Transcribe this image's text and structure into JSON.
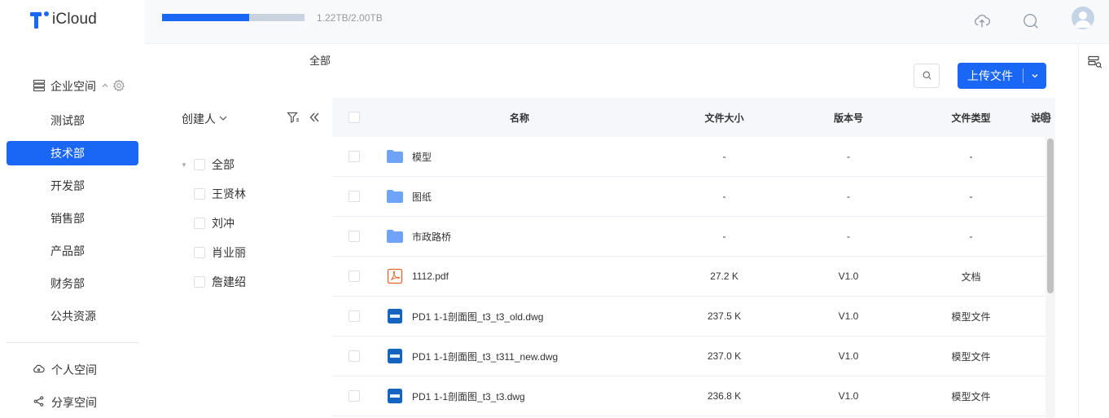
{
  "app": {
    "name": "iCloud"
  },
  "storage": {
    "text": "1.22TB/2.00TB",
    "used_fraction": 0.61
  },
  "sidebar": {
    "enterprise_label": "企业空间",
    "departments": [
      {
        "label": "测试部",
        "active": false
      },
      {
        "label": "技术部",
        "active": true
      },
      {
        "label": "开发部",
        "active": false
      },
      {
        "label": "销售部",
        "active": false
      },
      {
        "label": "产品部",
        "active": false
      },
      {
        "label": "财务部",
        "active": false
      },
      {
        "label": "公共资源",
        "active": false
      }
    ],
    "personal_label": "个人空间",
    "share_label": "分享空间"
  },
  "breadcrumb": "全部",
  "toolbar": {
    "upload_label": "上传文件"
  },
  "creator_filter": {
    "header": "创建人",
    "items": [
      "全部",
      "王贤林",
      "刘冲",
      "肖业丽",
      "詹建绍"
    ]
  },
  "table": {
    "columns": {
      "name": "名称",
      "size": "文件大小",
      "version": "版本号",
      "type": "文件类型",
      "desc": "说明"
    },
    "rows": [
      {
        "icon": "folder-icon",
        "name": "模型",
        "size": "-",
        "version": "-",
        "type": "-"
      },
      {
        "icon": "folder-icon",
        "name": "图纸",
        "size": "-",
        "version": "-",
        "type": "-"
      },
      {
        "icon": "folder-icon",
        "name": "市政路桥",
        "size": "-",
        "version": "-",
        "type": "-"
      },
      {
        "icon": "pdf-icon",
        "name": "1112.pdf",
        "size": "27.2 K",
        "version": "V1.0",
        "type": "文档"
      },
      {
        "icon": "dwg-icon",
        "name": "PD1 1-1剖面图_t3_t3_old.dwg",
        "size": "237.5 K",
        "version": "V1.0",
        "type": "模型文件"
      },
      {
        "icon": "dwg-icon",
        "name": "PD1 1-1剖面图_t3_t311_new.dwg",
        "size": "237.0 K",
        "version": "V1.0",
        "type": "模型文件"
      },
      {
        "icon": "dwg-icon",
        "name": "PD1 1-1剖面图_t3_t3.dwg",
        "size": "236.8 K",
        "version": "V1.0",
        "type": "模型文件"
      }
    ]
  },
  "colors": {
    "accent": "#1a67f5",
    "folder": "#6fa3f7",
    "pdf": "#e8642c",
    "dwg": "#1565c0"
  }
}
